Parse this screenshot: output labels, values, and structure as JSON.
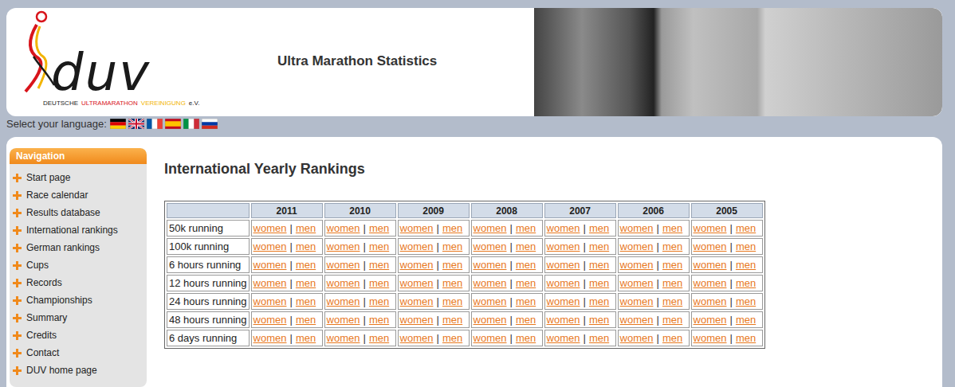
{
  "header": {
    "logo": {
      "mark": "duv",
      "caption": [
        {
          "text": "DEUTSCHE",
          "color": "#222222"
        },
        {
          "text": "ULTRAMARATHON",
          "color": "#d8141b"
        },
        {
          "text": "VEREINIGUNG",
          "color": "#f2b400"
        },
        {
          "text": "e.V.",
          "color": "#222222"
        }
      ]
    },
    "title": "Ultra Marathon Statistics"
  },
  "language": {
    "label": "Select your language:",
    "flags": [
      {
        "kind": "de"
      },
      {
        "kind": "gb"
      },
      {
        "kind": "fr"
      },
      {
        "kind": "es"
      },
      {
        "kind": "it"
      },
      {
        "kind": "ru"
      }
    ]
  },
  "navigation": {
    "title": "Navigation",
    "items": [
      "Start page",
      "Race calendar",
      "Results database",
      "International rankings",
      "German rankings",
      "Cups",
      "Records",
      "Championships",
      "Summary",
      "Credits",
      "Contact",
      "DUV home page"
    ]
  },
  "content": {
    "title": "International Yearly Rankings"
  },
  "table": {
    "columns": [
      "",
      "2011",
      "2010",
      "2009",
      "2008",
      "2007",
      "2006",
      "2005"
    ],
    "rows": [
      {
        "label": "50k running",
        "cells": [
          [
            "women",
            "|",
            "men"
          ],
          [
            "women",
            "|",
            "men"
          ],
          [
            "women",
            "|",
            "men"
          ],
          [
            "women",
            "|",
            "men"
          ],
          [
            "women",
            "|",
            "men"
          ],
          [
            "women",
            "|",
            "men"
          ],
          [
            "women",
            "|",
            "men"
          ]
        ]
      },
      {
        "label": "100k running",
        "cells": [
          [
            "women",
            "|",
            "men"
          ],
          [
            "women",
            "|",
            "men"
          ],
          [
            "women",
            "|",
            "men"
          ],
          [
            "women",
            "|",
            "men"
          ],
          [
            "women",
            "|",
            "men"
          ],
          [
            "women",
            "|",
            "men"
          ],
          [
            "women",
            "|",
            "men"
          ]
        ]
      },
      {
        "label": "6 hours running",
        "cells": [
          [
            "women",
            "|",
            "men"
          ],
          [
            "women",
            "|",
            "men"
          ],
          [
            "women",
            "|",
            "men"
          ],
          [
            "women",
            "|",
            "men"
          ],
          [
            "women",
            "|",
            "men"
          ],
          [
            "women",
            "|",
            "men"
          ],
          [
            "women",
            "|",
            "men"
          ]
        ]
      },
      {
        "label": "12 hours running",
        "cells": [
          [
            "women",
            "|",
            "men"
          ],
          [
            "women",
            "|",
            "men"
          ],
          [
            "women",
            "|",
            "men"
          ],
          [
            "women",
            "|",
            "men"
          ],
          [
            "women",
            "|",
            "men"
          ],
          [
            "women",
            "|",
            "men"
          ],
          [
            "women",
            "|",
            "men"
          ]
        ]
      },
      {
        "label": "24 hours running",
        "cells": [
          [
            "women",
            "|",
            "men"
          ],
          [
            "women",
            "|",
            "men"
          ],
          [
            "women",
            "|",
            "men"
          ],
          [
            "women",
            "|",
            "men"
          ],
          [
            "women",
            "|",
            "men"
          ],
          [
            "women",
            "|",
            "men"
          ],
          [
            "women",
            "|",
            "men"
          ]
        ]
      },
      {
        "label": "48 hours running",
        "cells": [
          [
            "women",
            "|",
            "men"
          ],
          [
            "women",
            "|",
            "men"
          ],
          [
            "women",
            "|",
            "men"
          ],
          [
            "women",
            "|",
            "men"
          ],
          [
            "women",
            "|",
            "men"
          ],
          [
            "women",
            "|",
            "men"
          ],
          [
            "women",
            "|",
            "men"
          ]
        ]
      },
      {
        "label": "6 days running",
        "cells": [
          [
            "women",
            "|",
            "men"
          ],
          [
            "women",
            "|",
            "men"
          ],
          [
            "women",
            "|",
            "men"
          ],
          [
            "women",
            "|",
            "men"
          ],
          [
            "women",
            "|",
            "men"
          ],
          [
            "women",
            "|",
            "men"
          ],
          [
            "women",
            "|",
            "men"
          ]
        ]
      }
    ]
  }
}
